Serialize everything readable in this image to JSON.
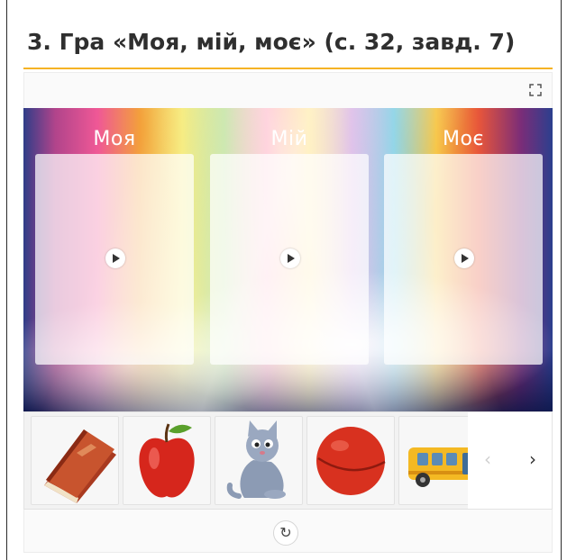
{
  "page": {
    "title": "3. Гра «Моя, мій, моє» (с. 32, завд. 7)"
  },
  "zones": [
    {
      "label": "Моя"
    },
    {
      "label": "Мій"
    },
    {
      "label": "Моє"
    }
  ],
  "tray": {
    "items": [
      {
        "icon": "book-icon"
      },
      {
        "icon": "apple-icon"
      },
      {
        "icon": "kitten-icon"
      },
      {
        "icon": "ball-icon"
      },
      {
        "icon": "bus-icon"
      }
    ],
    "prev_glyph": "‹",
    "next_glyph": "›"
  },
  "footer": {
    "reset_glyph": "↻"
  },
  "colors": {
    "title_rule": "#f5b324",
    "zone_label": "#ffffff"
  }
}
